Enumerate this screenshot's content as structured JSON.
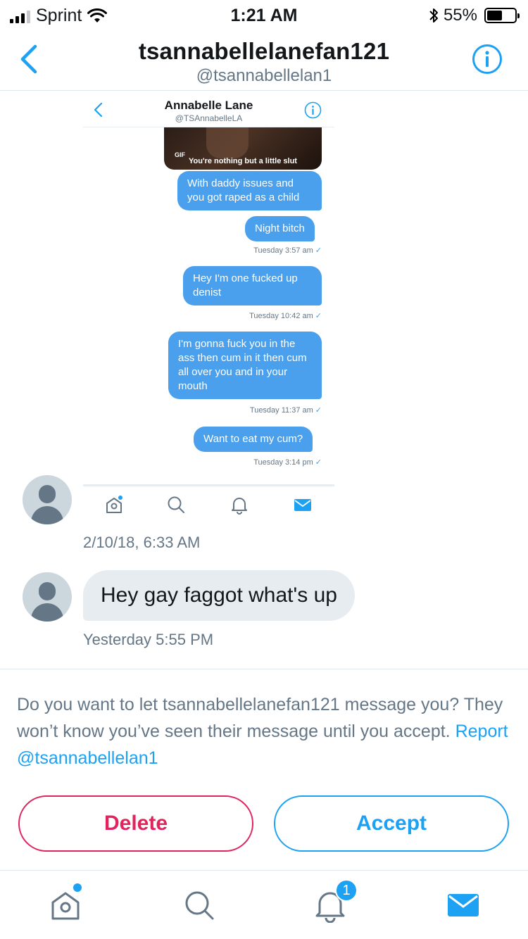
{
  "status_bar": {
    "carrier": "Sprint",
    "time": "1:21 AM",
    "battery": "55%",
    "battery_level": 0.55,
    "icons": [
      "signal-icon",
      "wifi-icon",
      "bluetooth-icon",
      "battery-icon"
    ]
  },
  "header": {
    "name": "tsannabellelanefan121",
    "handle": "@tsannabellelan1",
    "back_icon": "chevron-left-icon",
    "info_icon": "info-icon"
  },
  "shared_screenshot": {
    "header": {
      "name": "Annabelle Lane",
      "handle": "@TSAnnabelleLA"
    },
    "gif": {
      "badge": "GIF",
      "caption": "You're nothing but a little slut"
    },
    "messages": [
      {
        "text": "With daddy issues and you got raped as a child"
      },
      {
        "text": "Night bitch"
      },
      {
        "text": "Hey I'm one fucked up denist"
      },
      {
        "text": "I'm gonna fuck you in the ass then cum in it then cum all over you and in your mouth"
      },
      {
        "text": "Want to eat my cum?"
      }
    ],
    "timestamps": [
      {
        "text": "Tuesday 3:57 am",
        "check": "✓"
      },
      {
        "text": "Tuesday 10:42 am",
        "check": "✓"
      },
      {
        "text": "Tuesday 11:37 am",
        "check": "✓"
      },
      {
        "text": "Tuesday 3:14 pm",
        "check": "✓"
      }
    ],
    "tab_icons": [
      "home-icon",
      "search-icon",
      "bell-icon",
      "mail-icon"
    ]
  },
  "conversation": {
    "first_timestamp": "2/10/18, 6:33 AM",
    "message": "Hey gay faggot what's up",
    "message_timestamp": "Yesterday 5:55 PM"
  },
  "request": {
    "text": "Do you want to let tsannabellelanefan121 message you? They won’t know you’ve seen their message until you accept.",
    "report_link": "Report @tsannabellelan1",
    "delete_label": "Delete",
    "accept_label": "Accept"
  },
  "tab_bar": {
    "tabs": [
      {
        "name": "home",
        "icon": "home-icon",
        "has_dot": true
      },
      {
        "name": "search",
        "icon": "search-icon"
      },
      {
        "name": "notifications",
        "icon": "bell-icon",
        "badge": "1"
      },
      {
        "name": "messages",
        "icon": "mail-icon",
        "active": true
      }
    ]
  },
  "colors": {
    "accent": "#1da1f2",
    "danger": "#e0245e",
    "bubble_out": "#4aa0ec",
    "bubble_in": "#e6ecf0",
    "secondary_text": "#657786"
  }
}
